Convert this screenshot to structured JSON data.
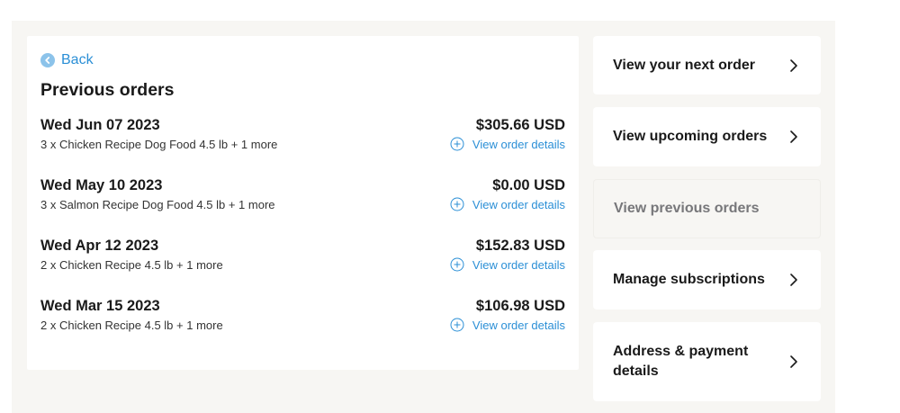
{
  "back": {
    "label": "Back"
  },
  "page_title": "Previous orders",
  "orders": [
    {
      "date": "Wed Jun 07 2023",
      "items": "3 x Chicken Recipe Dog Food 4.5 lb + 1 more",
      "total": "$305.66 USD",
      "link": "View order details"
    },
    {
      "date": "Wed May 10 2023",
      "items": "3 x Salmon Recipe Dog Food 4.5 lb + 1 more",
      "total": "$0.00 USD",
      "link": "View order details"
    },
    {
      "date": "Wed Apr 12 2023",
      "items": "2 x Chicken Recipe 4.5 lb + 1 more",
      "total": "$152.83 USD",
      "link": "View order details"
    },
    {
      "date": "Wed Mar 15 2023",
      "items": "2 x Chicken Recipe 4.5 lb + 1 more",
      "total": "$106.98 USD",
      "link": "View order details"
    }
  ],
  "nav": [
    {
      "label": "View your next order",
      "active": true
    },
    {
      "label": "View upcoming orders",
      "active": true
    },
    {
      "label": "View previous orders",
      "active": false
    },
    {
      "label": "Manage subscriptions",
      "active": true
    },
    {
      "label": "Address & payment details",
      "active": true
    }
  ],
  "colors": {
    "accent": "#2b8fd6",
    "background": "#f7f6f3",
    "card": "#ffffff",
    "text": "#1a1a1a",
    "muted": "#77777a"
  },
  "icons": {
    "back": "chevron-left-circle-icon",
    "order_link": "plus-circle-icon",
    "nav": "chevron-right-icon"
  }
}
